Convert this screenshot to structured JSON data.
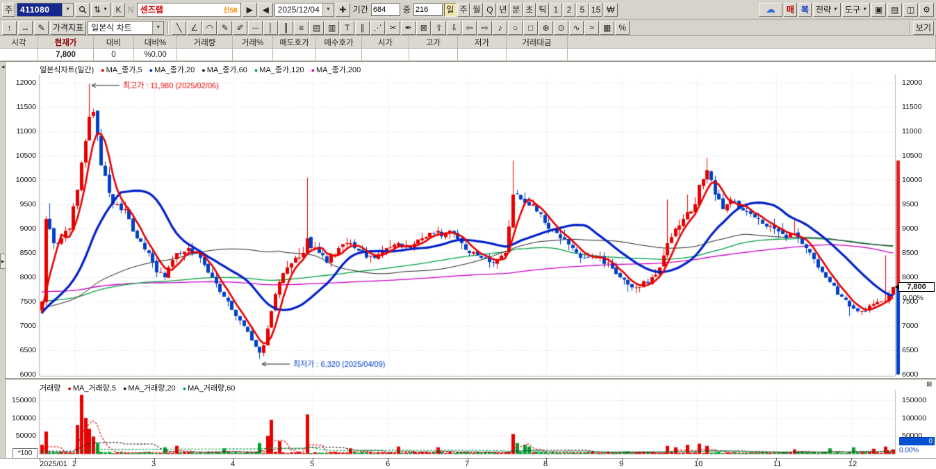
{
  "icons": {
    "dropdown": "▼",
    "sort": "⇅",
    "next": "▶",
    "prev": "◀",
    "calendar": "✚",
    "cloud": "☁",
    "up": "↑",
    "swap": "↔",
    "edit": "✎",
    "close": "⊠"
  },
  "toolbar_top": {
    "stock_type": "주",
    "stock_code": "411080",
    "k_label": "K",
    "n_label": "N",
    "stock_name": "센즈랩",
    "stock_badge": "신58",
    "date_value": "2025/12/04",
    "period_label": "기간",
    "period_value": "684",
    "mid_label": "중",
    "mid_value": "216",
    "timeframes": [
      "일",
      "주",
      "월",
      "Q",
      "년",
      "분",
      "초",
      "틱",
      "1",
      "2",
      "5",
      "15"
    ],
    "active_timeframe": "일",
    "won_label": "₩",
    "buy_label": "매",
    "restore_label": "복",
    "strategy_label": "전략",
    "tools_label": "도구",
    "right_icons": [
      {
        "name": "window-icon",
        "glyph": "▣"
      },
      {
        "name": "printer-icon",
        "glyph": "▤"
      },
      {
        "name": "save-icon",
        "glyph": "◫"
      },
      {
        "name": "wrench-icon",
        "glyph": "⚙"
      }
    ]
  },
  "toolbar_chart": {
    "price_indicator": "가격지표",
    "chart_type": "일본식 차트",
    "view_label": "보기",
    "tools": [
      {
        "name": "trend-line-icon",
        "glyph": "╲"
      },
      {
        "name": "angle-line-icon",
        "glyph": "∠"
      },
      {
        "name": "arc-icon",
        "glyph": "◠"
      },
      {
        "name": "pen-icon",
        "glyph": "✎"
      },
      {
        "name": "highlight-icon",
        "glyph": "✐"
      },
      {
        "name": "horizontal-line-icon",
        "glyph": "─"
      },
      {
        "name": "vertical-line-icon",
        "glyph": "│"
      },
      {
        "name": "double-vertical-icon",
        "glyph": "║"
      },
      {
        "name": "fib-lines-icon",
        "glyph": "≡"
      },
      {
        "name": "band-icon",
        "glyph": "▤"
      },
      {
        "name": "grid-icon",
        "glyph": "▥"
      },
      {
        "name": "text-tool-icon",
        "glyph": "T"
      },
      {
        "name": "channel-icon",
        "glyph": "∥"
      },
      {
        "name": "dots-diagonal-icon",
        "glyph": "⋰"
      },
      {
        "name": "scissors-icon",
        "glyph": "✂"
      },
      {
        "name": "write-icon",
        "glyph": "✒"
      },
      {
        "name": "delete-drawing-icon",
        "glyph": "⊠"
      },
      {
        "name": "arrow-up-icon",
        "glyph": "⇧"
      },
      {
        "name": "arrow-down-icon",
        "glyph": "⇩"
      },
      {
        "name": "arrow-left-icon",
        "glyph": "⇦"
      },
      {
        "name": "arrow-right-icon",
        "glyph": "⇨"
      },
      {
        "name": "note-icon",
        "glyph": "♪"
      },
      {
        "name": "circle-tool-icon",
        "glyph": "○"
      },
      {
        "name": "rect-tool-icon",
        "glyph": "□"
      },
      {
        "name": "zoom-in-icon",
        "glyph": "⊕"
      },
      {
        "name": "zoom-window-icon",
        "glyph": "⊙"
      },
      {
        "name": "wave-icon",
        "glyph": "∿"
      },
      {
        "name": "wave2-icon",
        "glyph": "≈"
      },
      {
        "name": "pattern-icon",
        "glyph": "▦"
      },
      {
        "name": "percent-icon",
        "glyph": "%"
      }
    ]
  },
  "quote": {
    "headers": [
      "시각",
      "현재가",
      "대비",
      "대비%",
      "거래량",
      "거래%",
      "매도호가",
      "매수호가",
      "시가",
      "고가",
      "저가",
      "거래대금"
    ],
    "values": [
      "",
      "7,800",
      "0",
      "%0.00",
      "",
      "",
      "",
      "",
      "",
      "",
      "",
      ""
    ]
  },
  "chart_data": {
    "type": "candlestick",
    "pane_title": "일본식차트(일간)",
    "ma_legend": [
      {
        "label": "MA_종가,5",
        "color": "#e80000",
        "period": 5,
        "width": 2.6
      },
      {
        "label": "MA_종가,20",
        "color": "#0020c8",
        "period": 20,
        "width": 3.2
      },
      {
        "label": "MA_종가,60",
        "color": "#202020",
        "period": 60,
        "width": 1.0
      },
      {
        "label": "MA_종가,120",
        "color": "#00a040",
        "period": 120,
        "width": 1.3
      },
      {
        "label": "MA_종가,200",
        "color": "#cc00cc",
        "period": 200,
        "width": 1.3
      }
    ],
    "y_ticks": [
      12000,
      11500,
      11000,
      10500,
      10000,
      9500,
      9000,
      8500,
      8000,
      7500,
      7000,
      6500,
      6000
    ],
    "x_labels": [
      {
        "label": "2025/01",
        "bar": 0
      },
      {
        "label": "2",
        "bar": 9
      },
      {
        "label": "3",
        "bar": 29
      },
      {
        "label": "4",
        "bar": 49
      },
      {
        "label": "5",
        "bar": 69
      },
      {
        "label": "6",
        "bar": 88
      },
      {
        "label": "7",
        "bar": 108
      },
      {
        "label": "8",
        "bar": 128
      },
      {
        "label": "9",
        "bar": 147
      },
      {
        "label": "10",
        "bar": 166
      },
      {
        "label": "11",
        "bar": 186
      },
      {
        "label": "12",
        "bar": 205
      }
    ],
    "bar_count": 216,
    "seed": 20251204,
    "up_color": "#e80000",
    "down_color": "#0040c8",
    "close_anchors": [
      [
        0,
        7500
      ],
      [
        1,
        9200
      ],
      [
        3,
        8700
      ],
      [
        5,
        8800
      ],
      [
        7,
        9000
      ],
      [
        9,
        9800
      ],
      [
        11,
        10800
      ],
      [
        12,
        11300
      ],
      [
        13,
        11400
      ],
      [
        15,
        10300
      ],
      [
        18,
        9500
      ],
      [
        21,
        9400
      ],
      [
        24,
        8800
      ],
      [
        27,
        8500
      ],
      [
        29,
        8100
      ],
      [
        31,
        8000
      ],
      [
        34,
        8500
      ],
      [
        37,
        8600
      ],
      [
        40,
        8400
      ],
      [
        43,
        8000
      ],
      [
        46,
        7600
      ],
      [
        49,
        7200
      ],
      [
        51,
        7000
      ],
      [
        53,
        6700
      ],
      [
        55,
        6450
      ],
      [
        56,
        6600
      ],
      [
        58,
        7300
      ],
      [
        60,
        7900
      ],
      [
        62,
        8200
      ],
      [
        64,
        8400
      ],
      [
        66,
        8500
      ],
      [
        67,
        8800
      ],
      [
        68,
        8600
      ],
      [
        70,
        8500
      ],
      [
        72,
        8300
      ],
      [
        75,
        8600
      ],
      [
        78,
        8700
      ],
      [
        81,
        8500
      ],
      [
        84,
        8400
      ],
      [
        87,
        8600
      ],
      [
        90,
        8700
      ],
      [
        93,
        8600
      ],
      [
        96,
        8800
      ],
      [
        99,
        8900
      ],
      [
        102,
        8900
      ],
      [
        104,
        8900
      ],
      [
        106,
        8700
      ],
      [
        108,
        8500
      ],
      [
        111,
        8400
      ],
      [
        114,
        8300
      ],
      [
        117,
        8500
      ],
      [
        119,
        9700
      ],
      [
        121,
        9600
      ],
      [
        124,
        9500
      ],
      [
        126,
        9300
      ],
      [
        128,
        9000
      ],
      [
        131,
        8800
      ],
      [
        134,
        8600
      ],
      [
        137,
        8400
      ],
      [
        140,
        8400
      ],
      [
        143,
        8300
      ],
      [
        146,
        8000
      ],
      [
        148,
        7850
      ],
      [
        151,
        7800
      ],
      [
        154,
        8000
      ],
      [
        156,
        8200
      ],
      [
        158,
        8700
      ],
      [
        160,
        9000
      ],
      [
        162,
        9200
      ],
      [
        165,
        9500
      ],
      [
        166,
        9900
      ],
      [
        168,
        10200
      ],
      [
        170,
        9700
      ],
      [
        172,
        9400
      ],
      [
        174,
        9600
      ],
      [
        176,
        9400
      ],
      [
        179,
        9300
      ],
      [
        182,
        9100
      ],
      [
        185,
        9000
      ],
      [
        188,
        8800
      ],
      [
        190,
        8900
      ],
      [
        193,
        8600
      ],
      [
        196,
        8200
      ],
      [
        199,
        7900
      ],
      [
        202,
        7600
      ],
      [
        204,
        7400
      ],
      [
        206,
        7300
      ],
      [
        208,
        7300
      ],
      [
        210,
        7450
      ],
      [
        212,
        7500
      ],
      [
        214,
        7650
      ],
      [
        215,
        7800
      ]
    ],
    "high_overrides": [
      [
        12,
        11980
      ],
      [
        67,
        10050
      ],
      [
        119,
        10400
      ],
      [
        158,
        9600
      ],
      [
        168,
        10450
      ],
      [
        213,
        8450
      ]
    ],
    "low_overrides": [
      [
        55,
        6320
      ],
      [
        148,
        7700
      ],
      [
        204,
        7200
      ]
    ],
    "annotation_high": {
      "text": "최고가 : 11,980 (2025/02/06)",
      "color": "#e80000"
    },
    "annotation_low": {
      "text": "최저가 : 6,320 (2025/04/09)",
      "color": "#0040c8"
    },
    "current_price_label": "7,800",
    "current_change_label": "0.00%",
    "volume": {
      "pane_title": "거래량",
      "legend": [
        {
          "label": "MA_거래량,5",
          "color": "#e80000",
          "period": 5
        },
        {
          "label": "MA_거래량,20",
          "color": "#202020",
          "period": 20
        },
        {
          "label": "MA_거래량,60",
          "color": "#00a040",
          "period": 60
        }
      ],
      "y_ticks": [
        150000,
        100000,
        50000
      ],
      "y_max": 175000,
      "unit_label": "*100",
      "up_color": "#e80000",
      "down_color": "#00a030",
      "right_value": "0",
      "right_pct": "0.00%",
      "spikes": {
        "0": 25000,
        "1": 62000,
        "9": 80000,
        "10": 165000,
        "11": 100000,
        "12": 70000,
        "13": 48000,
        "14": 30000,
        "31": 18000,
        "34": 22000,
        "46": 15000,
        "55": 30000,
        "57": 50000,
        "58": 95000,
        "60": 35000,
        "67": 110000,
        "78": 15000,
        "90": 20000,
        "100": 18000,
        "119": 55000,
        "120": 30000,
        "122": 25000,
        "123": 20000,
        "158": 22000,
        "160": 18000,
        "163": 25000,
        "166": 28000,
        "168": 22000,
        "190": 12000,
        "199": 15000,
        "205": 18000,
        "210": 14000,
        "213": 20000,
        "215": 12000
      }
    }
  }
}
